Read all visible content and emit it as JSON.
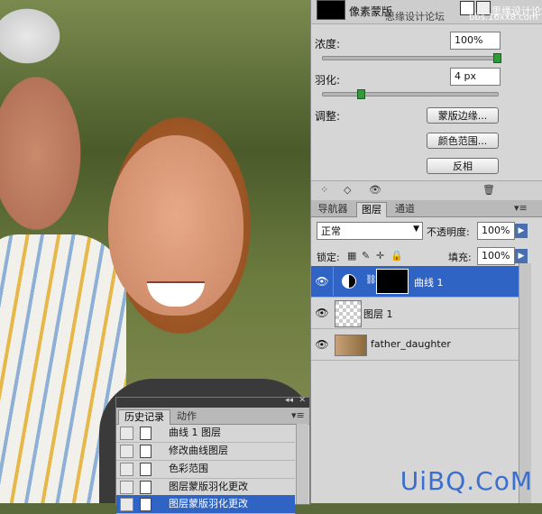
{
  "properties": {
    "mask_label": "像素蒙版",
    "site_watermark": "思缘设计论坛",
    "site_watermark2": "思缘设计论坛",
    "site_url": "bbs.16xx8.com",
    "density_label": "浓度:",
    "density_value": "100%",
    "density_fraction": 1.0,
    "feather_label": "羽化:",
    "feather_value": "4 px",
    "feather_fraction": 0.22,
    "adjust_label": "调整:",
    "mask_edge_button": "蒙版边缘...",
    "color_range_button": "颜色范围...",
    "invert_button": "反相"
  },
  "layers_panel": {
    "tabs": [
      "导航器",
      "图层",
      "通道"
    ],
    "active_tab": 1,
    "blend_mode": "正常",
    "opacity_label": "不透明度:",
    "opacity_value": "100%",
    "lock_label": "锁定:",
    "fill_label": "填充:",
    "fill_value": "100%",
    "layers": [
      {
        "name": "曲线 1",
        "selected": true
      },
      {
        "name": "图层 1",
        "selected": false
      },
      {
        "name": "father_daughter",
        "selected": false
      }
    ]
  },
  "history_panel": {
    "tabs": [
      "历史记录",
      "动作"
    ],
    "active_tab": 0,
    "items": [
      {
        "label": "曲线 1 图层",
        "selected": false
      },
      {
        "label": "修改曲线图层",
        "selected": false
      },
      {
        "label": "色彩范围",
        "selected": false
      },
      {
        "label": "图层蒙版羽化更改",
        "selected": false
      },
      {
        "label": "图层蒙版羽化更改",
        "selected": true
      }
    ]
  },
  "watermark": "UiBQ.CoM",
  "colors": {
    "selection": "#2f63c4",
    "panel_bg": "#d6d6d6",
    "slider_knob": "#2f9b3a",
    "watermark": "#3a6fd0"
  }
}
